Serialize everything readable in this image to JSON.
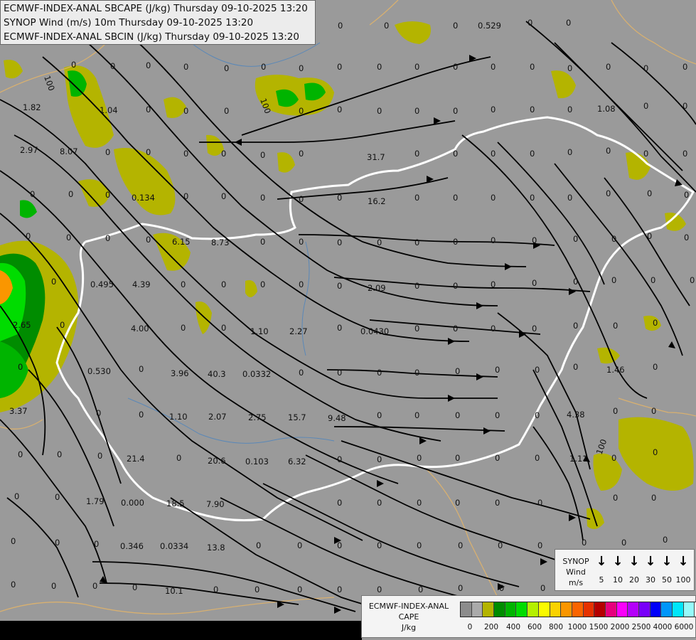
{
  "header": {
    "line1": "ECMWF-INDEX-ANAL SBCAPE (J/kg) Thursday 09-10-2025 13:20",
    "line2": "SYNOP Wind (m/s) 10m Thursday 09-10-2025 13:20",
    "line3": "ECMWF-INDEX-ANAL SBCIN (J/kg) Thursday 09-10-2025 13:20"
  },
  "wind_legend": {
    "label_line1": "SYNOP",
    "label_line2": "Wind",
    "label_line3": "m/s",
    "values": [
      "5",
      "10",
      "20",
      "30",
      "50",
      "100"
    ]
  },
  "cape_legend": {
    "label_line1": "ECMWF-INDEX-ANAL",
    "label_line2": "CAPE",
    "label_line3": "J/kg",
    "colors": [
      "#8c8c8c",
      "#aaaaaa",
      "#b4b400",
      "#008c00",
      "#00b400",
      "#00dc00",
      "#b4f000",
      "#fafa00",
      "#fad200",
      "#fa9600",
      "#fa6400",
      "#e63200",
      "#b40000",
      "#e6007d",
      "#fa00fa",
      "#b400fa",
      "#7800fa",
      "#0000fa",
      "#0096fa",
      "#00e6fa",
      "#96fafa",
      "#ffffff"
    ],
    "ticks": [
      "0",
      "200",
      "400",
      "600",
      "800",
      "1000",
      "1500",
      "2000",
      "2500",
      "4000",
      "6000"
    ]
  },
  "map_values": {
    "cin_labels": [
      {
        "t": "0.529"
      },
      {
        "t": "1.82"
      },
      {
        "t": "1.04"
      },
      {
        "t": "1.08"
      },
      {
        "t": "2.97"
      },
      {
        "t": "8.07"
      },
      {
        "t": "31.7"
      },
      {
        "t": "0.134"
      },
      {
        "t": "16.2"
      },
      {
        "t": "6.15"
      },
      {
        "t": "8.73"
      },
      {
        "t": "0.495"
      },
      {
        "t": "4.39"
      },
      {
        "t": "2.09"
      },
      {
        "t": "2.65"
      },
      {
        "t": "4.00"
      },
      {
        "t": "1.10"
      },
      {
        "t": "2.27"
      },
      {
        "t": "0.0430"
      },
      {
        "t": "0.530"
      },
      {
        "t": "3.96"
      },
      {
        "t": "40.3"
      },
      {
        "t": "0.0332"
      },
      {
        "t": "1.46"
      },
      {
        "t": "3.37"
      },
      {
        "t": "1.10"
      },
      {
        "t": "2.07"
      },
      {
        "t": "2.75"
      },
      {
        "t": "15.7"
      },
      {
        "t": "9.48"
      },
      {
        "t": "4.38"
      },
      {
        "t": "21.4"
      },
      {
        "t": "20.6"
      },
      {
        "t": "0.103"
      },
      {
        "t": "6.32"
      },
      {
        "t": "1.11"
      },
      {
        "t": "1.79"
      },
      {
        "t": "0.000"
      },
      {
        "t": "18.5"
      },
      {
        "t": "7.90"
      },
      {
        "t": "0.346"
      },
      {
        "t": "0.0334"
      },
      {
        "t": "13.8"
      },
      {
        "t": "10.1"
      },
      {
        "t": "100"
      },
      {
        "t": "100"
      },
      {
        "t": "100"
      }
    ],
    "zero_label": "0"
  },
  "colors": {
    "background": "#9a9a9a",
    "border": "#ffffff",
    "cape_low": "#b4b400",
    "cape_mid": "#008c00",
    "cape_high": "#00dc00",
    "streamline": "#000000"
  }
}
